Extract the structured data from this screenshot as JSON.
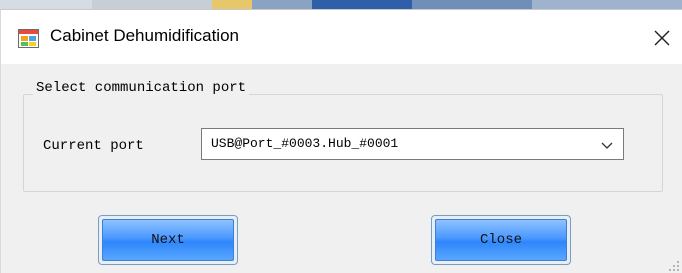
{
  "window": {
    "title": "Cabinet Dehumidification",
    "icon": "app-window-icon",
    "close_icon": "close-icon"
  },
  "group": {
    "label": "Select communication port"
  },
  "port": {
    "label": "Current port",
    "value": "USB@Port_#0003.Hub_#0001",
    "dropdown_icon": "chevron-down-icon"
  },
  "buttons": {
    "next_label": "Next",
    "close_label": "Close"
  },
  "colors": {
    "client_bg": "#f0f0f0",
    "button_blue": "#4a98ff",
    "button_border": "#7a9dbf"
  }
}
